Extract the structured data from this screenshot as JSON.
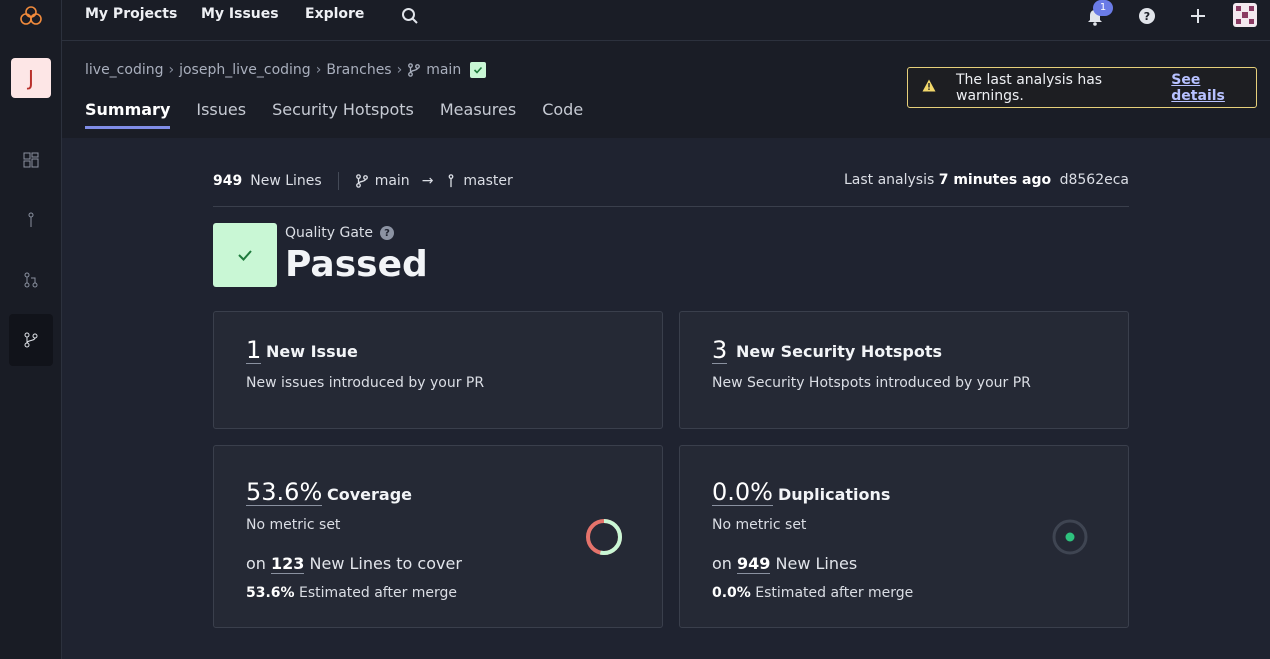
{
  "topnav": {
    "my_projects": "My Projects",
    "my_issues": "My Issues",
    "explore": "Explore",
    "notification_count": "1"
  },
  "sidebar": {
    "avatar_letter": "J"
  },
  "breadcrumb": {
    "items": [
      "live_coding",
      "joseph_live_coding",
      "Branches",
      "main"
    ]
  },
  "tabs": [
    "Summary",
    "Issues",
    "Security Hotspots",
    "Measures",
    "Code"
  ],
  "warning": {
    "text": "The last analysis has warnings.",
    "link": "See details"
  },
  "stats": {
    "new_lines_count": "949",
    "new_lines_label": "New Lines",
    "source_branch": "main",
    "target_branch": "master",
    "last_analysis_label": "Last analysis",
    "last_analysis_time": "7 minutes ago",
    "commit": "d8562eca"
  },
  "quality_gate": {
    "label": "Quality Gate",
    "status": "Passed"
  },
  "cards": {
    "issues": {
      "value": "1",
      "title": "New Issue",
      "sub": "New issues introduced by your PR"
    },
    "hotspots": {
      "value": "3",
      "title": "New Security Hotspots",
      "sub": "New Security Hotspots introduced by your PR"
    },
    "coverage": {
      "value": "53.6%",
      "title": "Coverage",
      "sub": "No metric set",
      "line_prefix": "on",
      "line_value": "123",
      "line_suffix": "New Lines to cover",
      "est_value": "53.6%",
      "est_label": "Estimated after merge",
      "percent": 53.6
    },
    "duplications": {
      "value": "0.0%",
      "title": "Duplications",
      "sub": "No metric set",
      "line_prefix": "on",
      "line_value": "949",
      "line_suffix": "New Lines",
      "est_value": "0.0%",
      "est_label": "Estimated after merge"
    }
  },
  "colors": {
    "accent": "#7f8ce6",
    "passed_bg": "#c9f7d5",
    "passed_check": "#1e7a3c",
    "coverage_covered": "#c9f7d5",
    "coverage_uncovered": "#e5736b",
    "warning_border": "#e6d07a"
  }
}
